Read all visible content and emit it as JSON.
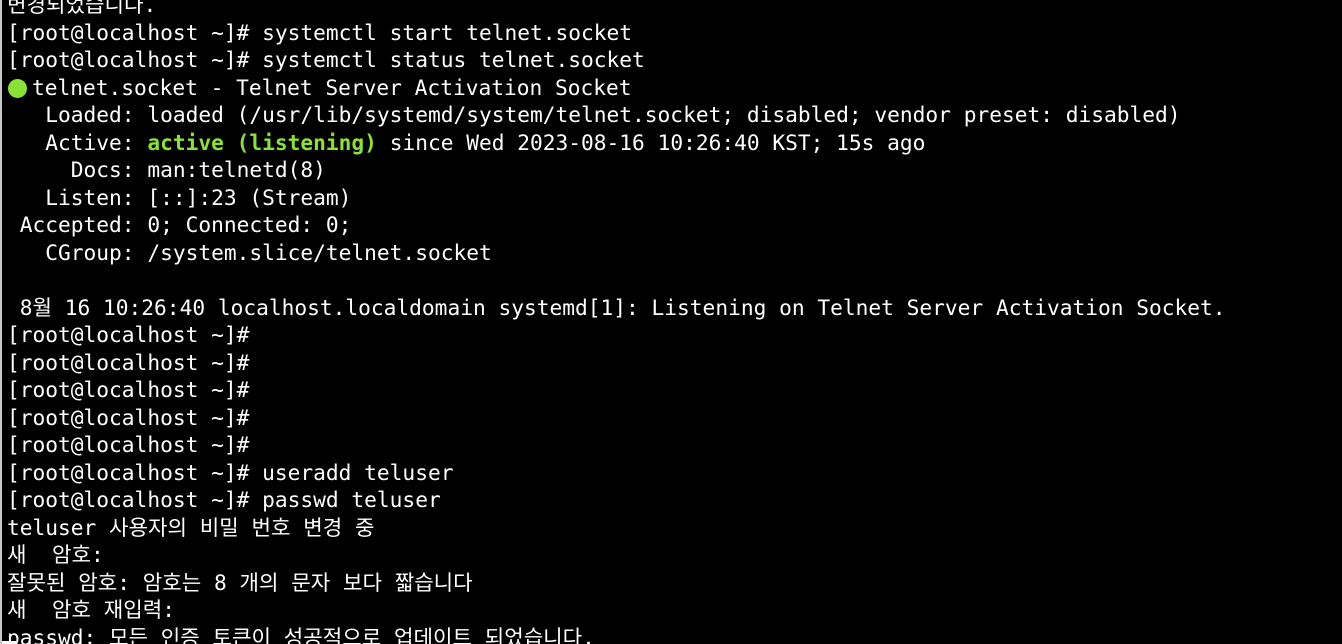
{
  "terminal": {
    "lines": [
      "변경되었습니다.",
      "[root@localhost ~]# systemctl start telnet.socket",
      "[root@localhost ~]# systemctl status telnet.socket",
      "telnet.socket - Telnet Server Activation Socket",
      "   Loaded: loaded (/usr/lib/systemd/system/telnet.socket; disabled; vendor preset: disabled)",
      "   Active: ",
      "     Docs: man:telnetd(8)",
      "   Listen: [::]:23 (Stream)",
      " Accepted: 0; Connected: 0;",
      "   CGroup: /system.slice/telnet.socket",
      "",
      " 8월 16 10:26:40 localhost.localdomain systemd[1]: Listening on Telnet Server Activation Socket.",
      "[root@localhost ~]#",
      "[root@localhost ~]#",
      "[root@localhost ~]#",
      "[root@localhost ~]#",
      "[root@localhost ~]#",
      "[root@localhost ~]# useradd teluser",
      "[root@localhost ~]# passwd teluser",
      "teluser 사용자의 비밀 번호 변경 중",
      "새  암호:",
      "잘못된 암호: 암호는 8 개의 문자 보다 짧습니다",
      "새  암호 재입력:",
      "passwd: 모든 인증 토큰이 성공적으로 업데이트 되었습니다."
    ],
    "active_state": "active (listening)",
    "active_since": " since Wed 2023-08-16 10:26:40 KST; 15s ago",
    "colors": {
      "background": "#000000",
      "foreground": "#ffffff",
      "active_green": "#8ae234"
    },
    "icons": {
      "status": "status-dot-icon"
    }
  }
}
